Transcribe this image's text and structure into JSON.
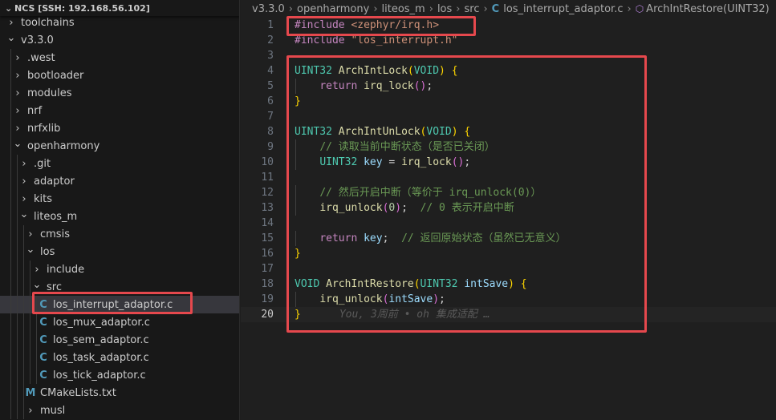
{
  "sidebar": {
    "title": "NCS [SSH: 192.168.56.102]",
    "items": [
      {
        "label": "toolchains",
        "depth": 0,
        "kind": "folder",
        "open": false
      },
      {
        "label": "v3.3.0",
        "depth": 0,
        "kind": "folder",
        "open": true
      },
      {
        "label": ".west",
        "depth": 1,
        "kind": "folder",
        "open": false
      },
      {
        "label": "bootloader",
        "depth": 1,
        "kind": "folder",
        "open": false
      },
      {
        "label": "modules",
        "depth": 1,
        "kind": "folder",
        "open": false
      },
      {
        "label": "nrf",
        "depth": 1,
        "kind": "folder",
        "open": false
      },
      {
        "label": "nrfxlib",
        "depth": 1,
        "kind": "folder",
        "open": false
      },
      {
        "label": "openharmony",
        "depth": 1,
        "kind": "folder",
        "open": true
      },
      {
        "label": ".git",
        "depth": 2,
        "kind": "folder",
        "open": false
      },
      {
        "label": "adaptor",
        "depth": 2,
        "kind": "folder",
        "open": false
      },
      {
        "label": "kits",
        "depth": 2,
        "kind": "folder",
        "open": false
      },
      {
        "label": "liteos_m",
        "depth": 2,
        "kind": "folder",
        "open": true
      },
      {
        "label": "cmsis",
        "depth": 3,
        "kind": "folder",
        "open": false
      },
      {
        "label": "los",
        "depth": 3,
        "kind": "folder",
        "open": true
      },
      {
        "label": "include",
        "depth": 4,
        "kind": "folder",
        "open": false
      },
      {
        "label": "src",
        "depth": 4,
        "kind": "folder",
        "open": true
      },
      {
        "label": "los_interrupt_adaptor.c",
        "depth": 5,
        "kind": "c-file",
        "selected": true
      },
      {
        "label": "los_mux_adaptor.c",
        "depth": 5,
        "kind": "c-file"
      },
      {
        "label": "los_sem_adaptor.c",
        "depth": 5,
        "kind": "c-file"
      },
      {
        "label": "los_task_adaptor.c",
        "depth": 5,
        "kind": "c-file"
      },
      {
        "label": "los_tick_adaptor.c",
        "depth": 5,
        "kind": "c-file"
      },
      {
        "label": "CMakeLists.txt",
        "depth": 3,
        "kind": "cmake-file"
      },
      {
        "label": "musl",
        "depth": 3,
        "kind": "folder",
        "open": false
      }
    ]
  },
  "breadcrumb": {
    "segments": [
      "v3.3.0",
      "openharmony",
      "liteos_m",
      "los",
      "src"
    ],
    "file": "los_interrupt_adaptor.c",
    "symbol": "ArchIntRestore(UINT32)"
  },
  "editor": {
    "active_line": 20,
    "lines": [
      {
        "n": "1",
        "tokens": [
          [
            "pp",
            "#include "
          ],
          [
            "str",
            "<zephyr/irq.h>"
          ]
        ]
      },
      {
        "n": "2",
        "tokens": [
          [
            "pp",
            "#include "
          ],
          [
            "str",
            "\"los_interrupt.h\""
          ]
        ]
      },
      {
        "n": "3",
        "tokens": []
      },
      {
        "n": "4",
        "tokens": [
          [
            "ty",
            "UINT32"
          ],
          [
            "pun",
            " "
          ],
          [
            "fn",
            "ArchIntLock"
          ],
          [
            "br1",
            "("
          ],
          [
            "ty",
            "VOID"
          ],
          [
            "br1",
            ")"
          ],
          [
            "pun",
            " "
          ],
          [
            "br1",
            "{"
          ]
        ]
      },
      {
        "n": "5",
        "tokens": [
          [
            "pun",
            "    "
          ],
          [
            "pp",
            "return"
          ],
          [
            "pun",
            " "
          ],
          [
            "fn",
            "irq_lock"
          ],
          [
            "br2",
            "()"
          ],
          [
            "pun",
            ";"
          ]
        ]
      },
      {
        "n": "6",
        "tokens": [
          [
            "br1",
            "}"
          ]
        ]
      },
      {
        "n": "7",
        "tokens": []
      },
      {
        "n": "8",
        "tokens": [
          [
            "ty",
            "UINT32"
          ],
          [
            "pun",
            " "
          ],
          [
            "fn",
            "ArchIntUnLock"
          ],
          [
            "br1",
            "("
          ],
          [
            "ty",
            "VOID"
          ],
          [
            "br1",
            ")"
          ],
          [
            "pun",
            " "
          ],
          [
            "br1",
            "{"
          ]
        ]
      },
      {
        "n": "9",
        "tokens": [
          [
            "pun",
            "    "
          ],
          [
            "cm",
            "// 读取当前中断状态（是否已关闭）"
          ]
        ]
      },
      {
        "n": "10",
        "tokens": [
          [
            "pun",
            "    "
          ],
          [
            "ty",
            "UINT32"
          ],
          [
            "pun",
            " "
          ],
          [
            "var",
            "key"
          ],
          [
            "pun",
            " = "
          ],
          [
            "fn",
            "irq_lock"
          ],
          [
            "br2",
            "()"
          ],
          [
            "pun",
            ";"
          ]
        ]
      },
      {
        "n": "11",
        "tokens": []
      },
      {
        "n": "12",
        "tokens": [
          [
            "pun",
            "    "
          ],
          [
            "cm",
            "// 然后开启中断（等价于 irq_unlock(0)）"
          ]
        ]
      },
      {
        "n": "13",
        "tokens": [
          [
            "pun",
            "    "
          ],
          [
            "fn",
            "irq_unlock"
          ],
          [
            "br2",
            "("
          ],
          [
            "num",
            "0"
          ],
          [
            "br2",
            ")"
          ],
          [
            "pun",
            ";  "
          ],
          [
            "cm",
            "// 0 表示开启中断"
          ]
        ]
      },
      {
        "n": "14",
        "tokens": []
      },
      {
        "n": "15",
        "tokens": [
          [
            "pun",
            "    "
          ],
          [
            "pp",
            "return"
          ],
          [
            "pun",
            " "
          ],
          [
            "var",
            "key"
          ],
          [
            "pun",
            ";  "
          ],
          [
            "cm",
            "// 返回原始状态（虽然已无意义）"
          ]
        ]
      },
      {
        "n": "16",
        "tokens": [
          [
            "br1",
            "}"
          ]
        ]
      },
      {
        "n": "17",
        "tokens": []
      },
      {
        "n": "18",
        "tokens": [
          [
            "ty",
            "VOID"
          ],
          [
            "pun",
            " "
          ],
          [
            "fn",
            "ArchIntRestore"
          ],
          [
            "br1",
            "("
          ],
          [
            "ty",
            "UINT32"
          ],
          [
            "pun",
            " "
          ],
          [
            "var",
            "intSave"
          ],
          [
            "br1",
            ")"
          ],
          [
            "pun",
            " "
          ],
          [
            "br1",
            "{"
          ]
        ]
      },
      {
        "n": "19",
        "tokens": [
          [
            "pun",
            "    "
          ],
          [
            "fn",
            "irq_unlock"
          ],
          [
            "br2",
            "("
          ],
          [
            "var",
            "intSave"
          ],
          [
            "br2",
            ")"
          ],
          [
            "pun",
            ";"
          ]
        ]
      },
      {
        "n": "20",
        "tokens": [
          [
            "br1",
            "}"
          ]
        ],
        "blame": "You, 3周前 • oh 集成适配 …"
      }
    ]
  },
  "colors": {
    "highlight_border": "#e5484d",
    "selection": "#37373d",
    "c_file_icon": "#519aba"
  }
}
